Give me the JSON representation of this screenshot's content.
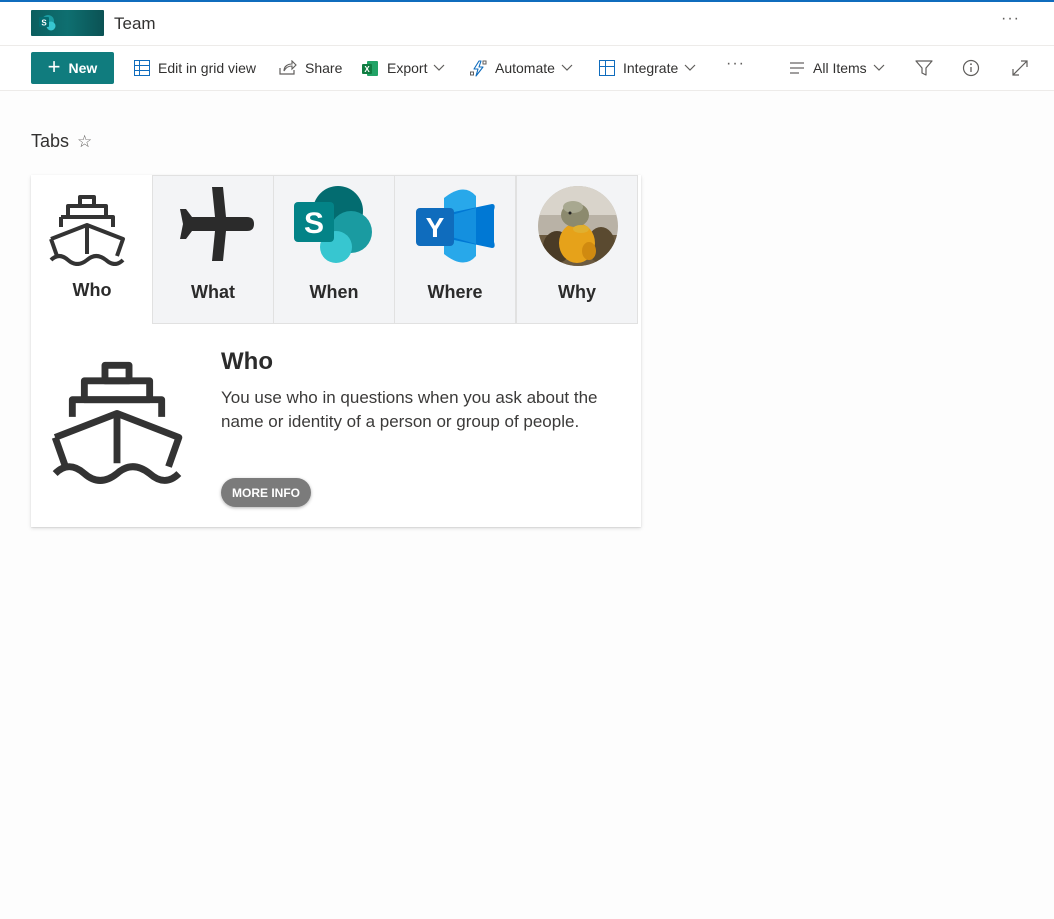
{
  "header": {
    "site_title": "Team",
    "more": "···"
  },
  "commandbar": {
    "new_label": "New",
    "edit_grid_label": "Edit in grid view",
    "share_label": "Share",
    "export_label": "Export",
    "automate_label": "Automate",
    "integrate_label": "Integrate",
    "more": "···",
    "view_label": "All Items"
  },
  "page": {
    "title": "Tabs",
    "star": "☆"
  },
  "tabs": [
    {
      "label": "Who",
      "icon": "ship-icon",
      "active": true
    },
    {
      "label": "What",
      "icon": "airplane-icon",
      "active": false
    },
    {
      "label": "When",
      "icon": "sharepoint-icon",
      "active": false
    },
    {
      "label": "Where",
      "icon": "yammer-icon",
      "active": false
    },
    {
      "label": "Why",
      "icon": "duck-photo",
      "active": false
    }
  ],
  "detail": {
    "title": "Who",
    "text": "You use who in questions when you ask about the name or identity of a person or group of people.",
    "button_label": "MORE INFO"
  },
  "colors": {
    "brand": "#107c7e",
    "accent_line": "#0f6cbd",
    "button_gray": "#7b7b7b"
  }
}
